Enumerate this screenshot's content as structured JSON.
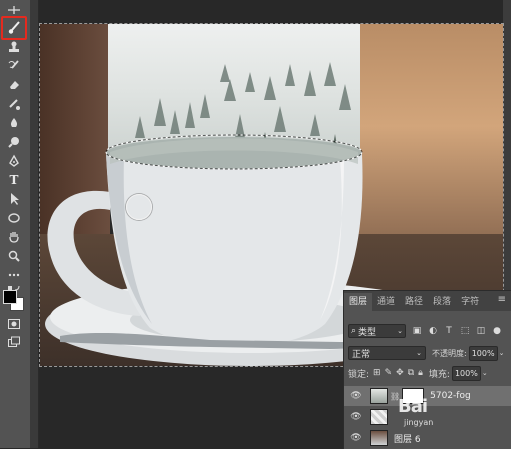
{
  "toolbar": {
    "tools": [
      "move-icon",
      "brush-icon",
      "stamp-icon",
      "history-brush-icon",
      "eraser-icon",
      "gradient-icon",
      "blur-icon",
      "dodge-icon",
      "pen-icon",
      "type-icon",
      "path-selection-icon",
      "ellipse-icon",
      "hand-icon",
      "zoom-icon",
      "more-icons",
      "swap-colors-icon",
      "quick-mask-icon",
      "screen-mode-icon"
    ],
    "type_tool_label": "T",
    "selected_tool": "brush-icon",
    "highlight_color": "#e52a1f",
    "foreground_color": "#000000",
    "background_color": "#ffffff"
  },
  "layers_panel": {
    "tabs": [
      "图层",
      "通道",
      "路径",
      "段落",
      "字符"
    ],
    "active_tab": "图层",
    "filter_label": "类型",
    "blend_mode": "正常",
    "opacity_label": "不透明度:",
    "opacity_value": "100%",
    "lock_label": "锁定:",
    "fill_label": "填充:",
    "fill_value": "100%",
    "layers": [
      {
        "name": "5702-fog",
        "visible": true,
        "selected": true,
        "has_mask": true
      },
      {
        "name": "",
        "visible": true,
        "selected": false,
        "has_mask": false
      },
      {
        "name": "图层 6",
        "visible": true,
        "selected": false,
        "has_mask": false
      }
    ]
  },
  "watermark": {
    "text": "Bai",
    "sub": "jingyan"
  }
}
